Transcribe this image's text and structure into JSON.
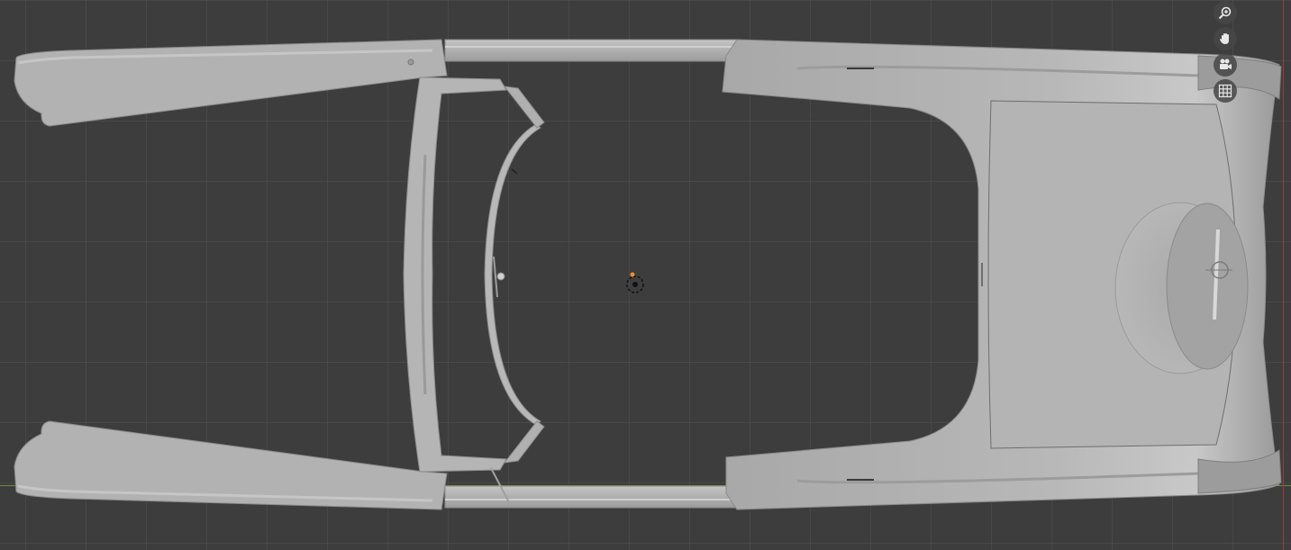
{
  "viewport": {
    "grid_color": "#4a4a4a",
    "background_color": "#3d3d3d",
    "x_axis_color": "#6a8f2a",
    "y_axis_color": "#a33a3a",
    "model_color": "#b4b4b4"
  },
  "navigation": {
    "items": [
      {
        "name": "zoom",
        "icon": "zoom-icon"
      },
      {
        "name": "pan",
        "icon": "hand-icon"
      },
      {
        "name": "camera",
        "icon": "camera-icon"
      },
      {
        "name": "grid",
        "icon": "grid-icon"
      }
    ]
  },
  "object": {
    "origin_color": "#f28c28"
  }
}
